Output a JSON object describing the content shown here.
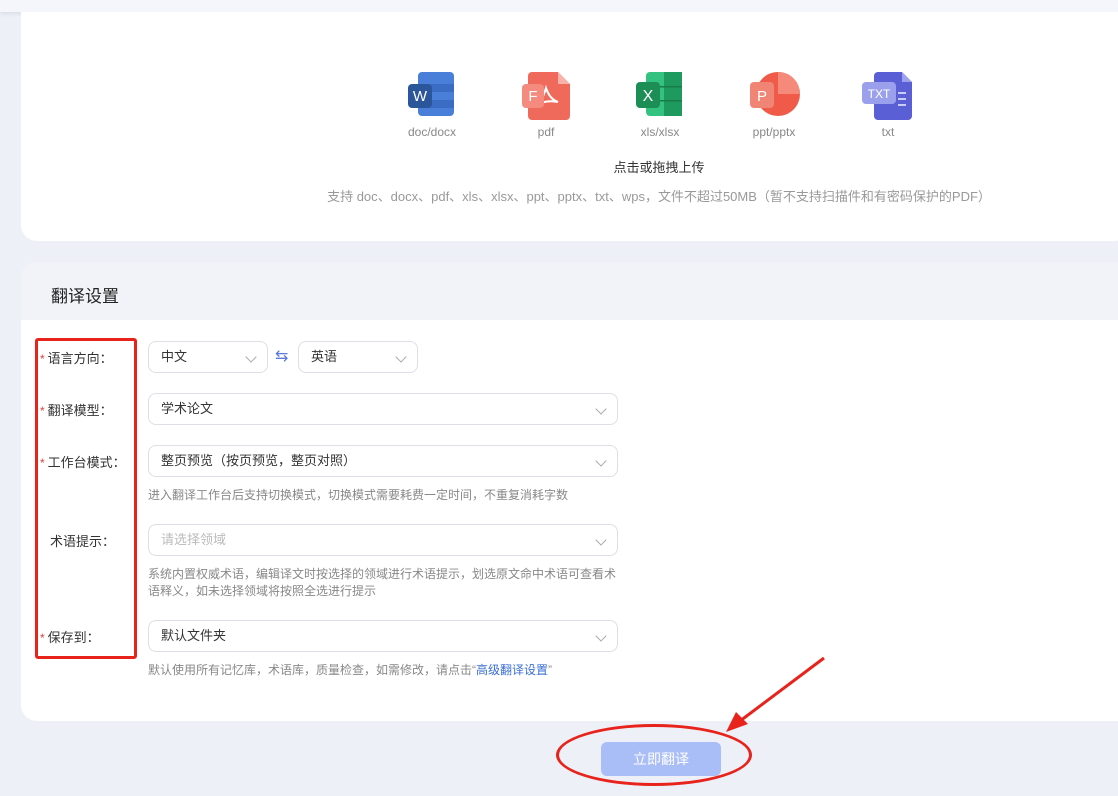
{
  "upload": {
    "file_types": [
      {
        "label": "doc/docx",
        "letter": "W",
        "color": "#2b579a",
        "icon": "word-icon"
      },
      {
        "label": "pdf",
        "letter": "F",
        "color": "#e8483c",
        "icon": "pdf-icon"
      },
      {
        "label": "xls/xlsx",
        "letter": "X",
        "color": "#21a366",
        "icon": "excel-icon"
      },
      {
        "label": "ppt/pptx",
        "letter": "P",
        "color": "#e5533f",
        "icon": "powerpoint-icon"
      },
      {
        "label": "txt",
        "letter": "TXT",
        "color": "#5a5fd6",
        "icon": "txt-icon"
      }
    ],
    "hint": "点击或拖拽上传",
    "support": "支持 doc、docx、pdf、xls、xlsx、ppt、pptx、txt、wps，文件不超过50MB（暂不支持扫描件和有密码保护的PDF）"
  },
  "settings": {
    "title": "翻译设置",
    "required_mark": "*",
    "language": {
      "label": "语言方向：",
      "source": "中文",
      "target": "英语",
      "swap_icon": "⇆"
    },
    "model": {
      "label": "翻译模型：",
      "value": "学术论文"
    },
    "workspace": {
      "label": "工作台模式：",
      "value": "整页预览（按页预览，整页对照）",
      "hint": "进入翻译工作台后支持切换模式，切换模式需要耗费一定时间，不重复消耗字数"
    },
    "terminology": {
      "label": "术语提示：",
      "placeholder": "请选择领域",
      "hint_line1": "系统内置权威术语，编辑译文时按选择的领域进行术语提示，划选原文命中术语可查看术",
      "hint_line2": "语释义，如未选择领域将按照全选进行提示"
    },
    "save": {
      "label": "保存到：",
      "value": "默认文件夹",
      "hint_prefix": "默认使用所有记忆库，术语库，质量检查，如需修改，请点击“",
      "hint_link": "高级翻译设置",
      "hint_suffix": "”"
    }
  },
  "submit_label": "立即翻译",
  "colors": {
    "accent": "#a9bdf7",
    "annotation_red": "#e8231c",
    "link": "#3b6fd6"
  }
}
